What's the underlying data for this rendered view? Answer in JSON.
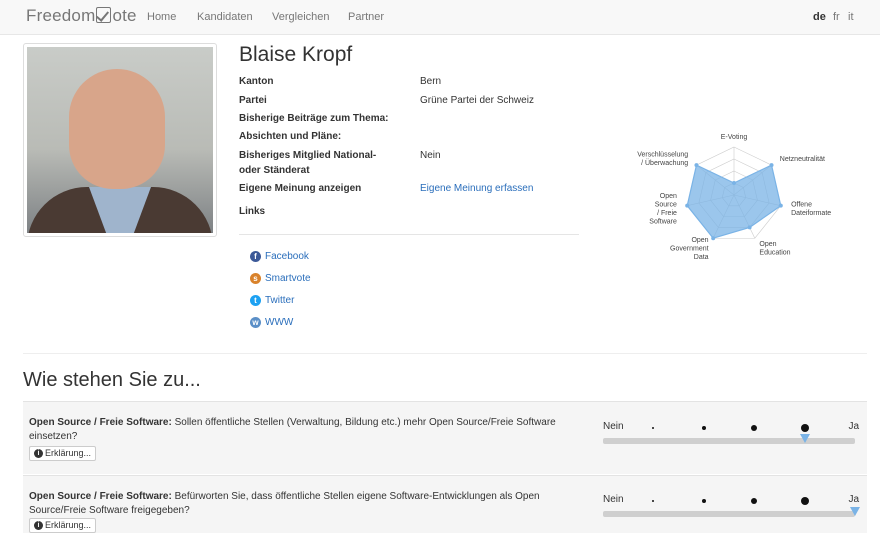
{
  "navbar": {
    "brand_left": "Freedom",
    "brand_right": "ote",
    "items": [
      {
        "label": "Home"
      },
      {
        "label": "Kandidaten"
      },
      {
        "label": "Vergleichen"
      },
      {
        "label": "Partner"
      }
    ],
    "languages": [
      {
        "label": "de",
        "active": true
      },
      {
        "label": "fr",
        "active": false
      },
      {
        "label": "it",
        "active": false
      }
    ]
  },
  "profile": {
    "name": "Blaise Kropf",
    "fields": [
      {
        "label": "Kanton",
        "value": "Bern"
      },
      {
        "label": "Partei",
        "value": "Grüne Partei der Schweiz"
      },
      {
        "label": "Bisherige Beiträge zum Thema:",
        "value": ""
      },
      {
        "label": "Absichten und Pläne:",
        "value": ""
      },
      {
        "label": "Bisheriges Mitglied National-",
        "label2": "oder Ständerat",
        "value": "Nein"
      },
      {
        "label": "Eigene Meinung anzeigen",
        "value": "Eigene Meinung erfassen"
      },
      {
        "label": "Links",
        "value": ""
      }
    ],
    "links": [
      {
        "label": "Facebook",
        "icon": "facebook-icon",
        "color": "#3b5998"
      },
      {
        "label": "Smartvote",
        "icon": "smartvote-icon",
        "color": "#d9822b"
      },
      {
        "label": "Twitter",
        "icon": "twitter-icon",
        "color": "#1da1f2"
      },
      {
        "label": "WWW",
        "icon": "globe-icon",
        "color": "#5b8fc7"
      }
    ]
  },
  "radar": {
    "fill_color": "#7ab3e6",
    "axes": [
      {
        "lines": [
          "E-Voting"
        ]
      },
      {
        "lines": [
          "Netzneutralität"
        ]
      },
      {
        "lines": [
          "Offene",
          "Dateiformate"
        ]
      },
      {
        "lines": [
          "Open",
          "Education"
        ]
      },
      {
        "lines": [
          "Open",
          "Government",
          "Data"
        ]
      },
      {
        "lines": [
          "Open",
          "Source",
          "/ Freie",
          "Software"
        ]
      },
      {
        "lines": [
          "Verschlüsselung",
          "/ Überwachung"
        ]
      }
    ],
    "values": [
      0.25,
      1.0,
      1.0,
      0.75,
      1.0,
      1.0,
      1.0
    ]
  },
  "section": {
    "title": "Wie stehen Sie zu..."
  },
  "questions": [
    {
      "topic": "Open Source / Freie Software:",
      "text": " Sollen öffentliche Stellen (Verwaltung, Bildung etc.) mehr Open Source/Freie Software einsetzen?",
      "button": "Erklärung...",
      "scale_min": "Nein",
      "scale_max": "Ja",
      "position": 0.8
    },
    {
      "topic": "Open Source / Freie Software:",
      "text": " Befürworten Sie, dass öffentliche Stellen eigene Software-Entwicklungen als Open Source/Freie Software freigegeben?",
      "button": "Erklärung...",
      "scale_min": "Nein",
      "scale_max": "Ja",
      "position": 1.0
    }
  ]
}
